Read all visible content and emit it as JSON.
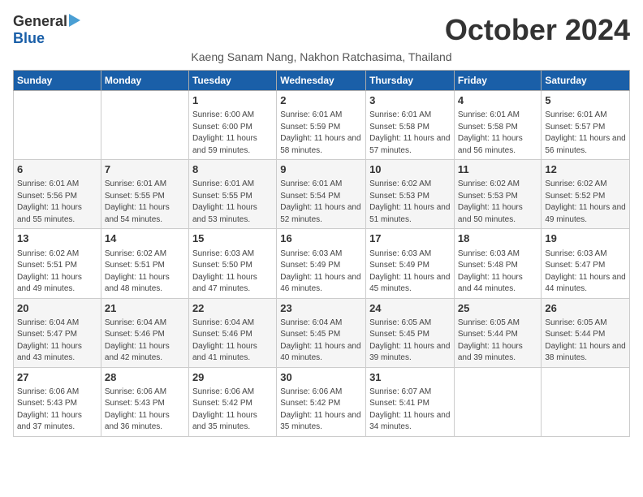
{
  "logo": {
    "general": "General",
    "blue": "Blue"
  },
  "title": "October 2024",
  "subtitle": "Kaeng Sanam Nang, Nakhon Ratchasima, Thailand",
  "headers": [
    "Sunday",
    "Monday",
    "Tuesday",
    "Wednesday",
    "Thursday",
    "Friday",
    "Saturday"
  ],
  "weeks": [
    [
      {
        "day": "",
        "info": ""
      },
      {
        "day": "",
        "info": ""
      },
      {
        "day": "1",
        "info": "Sunrise: 6:00 AM\nSunset: 6:00 PM\nDaylight: 11 hours and 59 minutes."
      },
      {
        "day": "2",
        "info": "Sunrise: 6:01 AM\nSunset: 5:59 PM\nDaylight: 11 hours and 58 minutes."
      },
      {
        "day": "3",
        "info": "Sunrise: 6:01 AM\nSunset: 5:58 PM\nDaylight: 11 hours and 57 minutes."
      },
      {
        "day": "4",
        "info": "Sunrise: 6:01 AM\nSunset: 5:58 PM\nDaylight: 11 hours and 56 minutes."
      },
      {
        "day": "5",
        "info": "Sunrise: 6:01 AM\nSunset: 5:57 PM\nDaylight: 11 hours and 56 minutes."
      }
    ],
    [
      {
        "day": "6",
        "info": "Sunrise: 6:01 AM\nSunset: 5:56 PM\nDaylight: 11 hours and 55 minutes."
      },
      {
        "day": "7",
        "info": "Sunrise: 6:01 AM\nSunset: 5:55 PM\nDaylight: 11 hours and 54 minutes."
      },
      {
        "day": "8",
        "info": "Sunrise: 6:01 AM\nSunset: 5:55 PM\nDaylight: 11 hours and 53 minutes."
      },
      {
        "day": "9",
        "info": "Sunrise: 6:01 AM\nSunset: 5:54 PM\nDaylight: 11 hours and 52 minutes."
      },
      {
        "day": "10",
        "info": "Sunrise: 6:02 AM\nSunset: 5:53 PM\nDaylight: 11 hours and 51 minutes."
      },
      {
        "day": "11",
        "info": "Sunrise: 6:02 AM\nSunset: 5:53 PM\nDaylight: 11 hours and 50 minutes."
      },
      {
        "day": "12",
        "info": "Sunrise: 6:02 AM\nSunset: 5:52 PM\nDaylight: 11 hours and 49 minutes."
      }
    ],
    [
      {
        "day": "13",
        "info": "Sunrise: 6:02 AM\nSunset: 5:51 PM\nDaylight: 11 hours and 49 minutes."
      },
      {
        "day": "14",
        "info": "Sunrise: 6:02 AM\nSunset: 5:51 PM\nDaylight: 11 hours and 48 minutes."
      },
      {
        "day": "15",
        "info": "Sunrise: 6:03 AM\nSunset: 5:50 PM\nDaylight: 11 hours and 47 minutes."
      },
      {
        "day": "16",
        "info": "Sunrise: 6:03 AM\nSunset: 5:49 PM\nDaylight: 11 hours and 46 minutes."
      },
      {
        "day": "17",
        "info": "Sunrise: 6:03 AM\nSunset: 5:49 PM\nDaylight: 11 hours and 45 minutes."
      },
      {
        "day": "18",
        "info": "Sunrise: 6:03 AM\nSunset: 5:48 PM\nDaylight: 11 hours and 44 minutes."
      },
      {
        "day": "19",
        "info": "Sunrise: 6:03 AM\nSunset: 5:47 PM\nDaylight: 11 hours and 44 minutes."
      }
    ],
    [
      {
        "day": "20",
        "info": "Sunrise: 6:04 AM\nSunset: 5:47 PM\nDaylight: 11 hours and 43 minutes."
      },
      {
        "day": "21",
        "info": "Sunrise: 6:04 AM\nSunset: 5:46 PM\nDaylight: 11 hours and 42 minutes."
      },
      {
        "day": "22",
        "info": "Sunrise: 6:04 AM\nSunset: 5:46 PM\nDaylight: 11 hours and 41 minutes."
      },
      {
        "day": "23",
        "info": "Sunrise: 6:04 AM\nSunset: 5:45 PM\nDaylight: 11 hours and 40 minutes."
      },
      {
        "day": "24",
        "info": "Sunrise: 6:05 AM\nSunset: 5:45 PM\nDaylight: 11 hours and 39 minutes."
      },
      {
        "day": "25",
        "info": "Sunrise: 6:05 AM\nSunset: 5:44 PM\nDaylight: 11 hours and 39 minutes."
      },
      {
        "day": "26",
        "info": "Sunrise: 6:05 AM\nSunset: 5:44 PM\nDaylight: 11 hours and 38 minutes."
      }
    ],
    [
      {
        "day": "27",
        "info": "Sunrise: 6:06 AM\nSunset: 5:43 PM\nDaylight: 11 hours and 37 minutes."
      },
      {
        "day": "28",
        "info": "Sunrise: 6:06 AM\nSunset: 5:43 PM\nDaylight: 11 hours and 36 minutes."
      },
      {
        "day": "29",
        "info": "Sunrise: 6:06 AM\nSunset: 5:42 PM\nDaylight: 11 hours and 35 minutes."
      },
      {
        "day": "30",
        "info": "Sunrise: 6:06 AM\nSunset: 5:42 PM\nDaylight: 11 hours and 35 minutes."
      },
      {
        "day": "31",
        "info": "Sunrise: 6:07 AM\nSunset: 5:41 PM\nDaylight: 11 hours and 34 minutes."
      },
      {
        "day": "",
        "info": ""
      },
      {
        "day": "",
        "info": ""
      }
    ]
  ]
}
